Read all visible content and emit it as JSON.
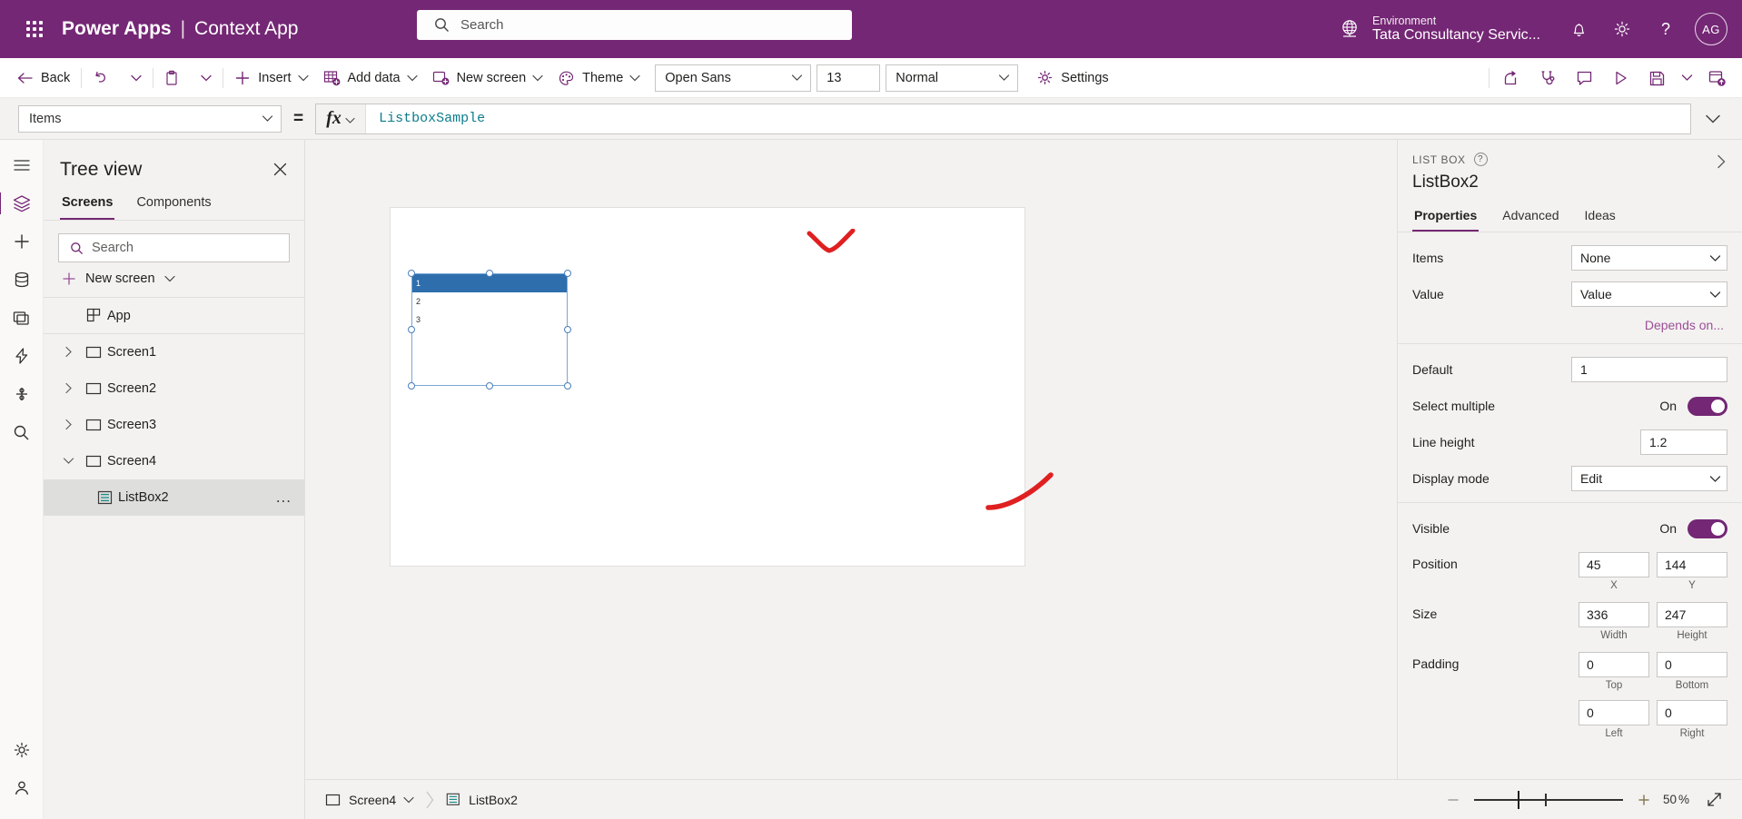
{
  "header": {
    "waffle_icon": "app-launcher-icon",
    "product": "Power Apps",
    "separator": "|",
    "app_name": "Context App",
    "search_placeholder": "Search",
    "search_value": "",
    "search_icon": "search-icon",
    "environment_label": "Environment",
    "environment_value": "Tata Consultancy Servic...",
    "globe_icon": "environment-globe-icon",
    "notification_icon": "bell-icon",
    "settings_icon": "gear-icon",
    "help_icon": "question-mark-icon",
    "avatar_initials": "AG",
    "brand_color": "#742774"
  },
  "command_bar": {
    "back": "Back",
    "back_icon": "arrow-left-icon",
    "undo_icon": "undo-icon",
    "undo_caret_icon": "chevron-down-icon",
    "paste_icon": "clipboard-icon",
    "paste_caret_icon": "chevron-down-icon",
    "insert": "Insert",
    "insert_icon": "plus-icon",
    "add_data": "Add data",
    "add_data_icon": "table-add-icon",
    "new_screen": "New screen",
    "new_screen_icon": "screen-add-icon",
    "theme": "Theme",
    "theme_icon": "palette-icon",
    "font_family": "Open Sans",
    "font_size": "13",
    "font_weight": "Normal",
    "settings": "Settings",
    "settings_icon": "gear-icon",
    "more_icon": "ellipsis-icon",
    "share_icon": "share-icon",
    "checker_icon": "app-checker-stethoscope-icon",
    "comments_icon": "comment-icon",
    "preview_icon": "play-triangle-icon",
    "save_icon": "save-disk-icon",
    "save_caret_icon": "chevron-down-icon",
    "publish_icon": "publish-icon"
  },
  "formula_bar": {
    "property": "Items",
    "property_caret_icon": "chevron-down-icon",
    "equals": "=",
    "fx_icon": "fx-icon",
    "fx_caret_icon": "chevron-down-icon",
    "formula": "ListboxSample",
    "expand_icon": "chevron-down-icon"
  },
  "rail": {
    "items": [
      {
        "name": "hamburger-menu-icon",
        "active": false
      },
      {
        "name": "tree-view-layers-icon",
        "active": true
      },
      {
        "name": "insert-plus-icon",
        "active": false
      },
      {
        "name": "data-cylinder-icon",
        "active": false
      },
      {
        "name": "media-icon",
        "active": false
      },
      {
        "name": "power-automate-icon",
        "active": false
      },
      {
        "name": "variables-icon",
        "active": false
      },
      {
        "name": "search-icon",
        "active": false
      }
    ],
    "bottom_items": [
      {
        "name": "settings-gear-icon"
      },
      {
        "name": "account-person-icon"
      }
    ]
  },
  "tree_view": {
    "title": "Tree view",
    "close_icon": "close-icon",
    "tabs": [
      {
        "label": "Screens",
        "active": true
      },
      {
        "label": "Components",
        "active": false
      }
    ],
    "search_placeholder": "Search",
    "search_value": "",
    "search_icon": "search-icon",
    "new_screen": "New screen",
    "new_screen_plus_icon": "plus-icon",
    "new_screen_caret_icon": "chevron-down-icon",
    "items": [
      {
        "label": "App",
        "icon": "app-grid-icon",
        "indent": 0,
        "chevron": "none",
        "selected": false,
        "divider": true
      },
      {
        "label": "Screen1",
        "icon": "screen-rect-icon",
        "indent": 1,
        "chevron": "right",
        "selected": false
      },
      {
        "label": "Screen2",
        "icon": "screen-rect-icon",
        "indent": 1,
        "chevron": "right",
        "selected": false
      },
      {
        "label": "Screen3",
        "icon": "screen-rect-icon",
        "indent": 1,
        "chevron": "right",
        "selected": false
      },
      {
        "label": "Screen4",
        "icon": "screen-rect-icon",
        "indent": 1,
        "chevron": "down",
        "selected": false
      },
      {
        "label": "ListBox2",
        "icon": "listbox-icon",
        "indent": 2,
        "chevron": "none",
        "selected": true,
        "dots": "..."
      }
    ]
  },
  "canvas": {
    "listbox_items": [
      {
        "label": "1",
        "selected": true
      },
      {
        "label": "2",
        "selected": false
      },
      {
        "label": "3",
        "selected": false
      }
    ],
    "annotation_color": "#e02020"
  },
  "status_bar": {
    "screen_crumb": "Screen4",
    "screen_icon": "screen-rect-icon",
    "screen_caret_icon": "chevron-down-icon",
    "crumb_sep_icon": "chevron-right-icon",
    "control_crumb": "ListBox2",
    "control_icon": "listbox-icon",
    "zoom_out_icon": "minus-icon",
    "zoom_in_icon": "plus-icon",
    "zoom_value": "50",
    "zoom_unit": "%",
    "fit_icon": "fit-to-screen-diagonal-icon"
  },
  "properties_panel": {
    "kind": "LIST BOX",
    "help_icon": "question-mark-circle-icon",
    "collapse_icon": "chevron-right-icon",
    "name": "ListBox2",
    "tabs": [
      {
        "label": "Properties",
        "active": true
      },
      {
        "label": "Advanced",
        "active": false
      },
      {
        "label": "Ideas",
        "active": false
      }
    ],
    "section1": [
      {
        "label": "Items",
        "type": "select",
        "value": "None",
        "caret_icon": "chevron-down-icon"
      },
      {
        "label": "Value",
        "type": "select",
        "value": "Value",
        "caret_icon": "chevron-down-icon"
      }
    ],
    "depends_on": "Depends on...",
    "section2": [
      {
        "label": "Default",
        "type": "text",
        "value": "1"
      },
      {
        "label": "Select multiple",
        "type": "toggle",
        "state": "On"
      },
      {
        "label": "Line height",
        "type": "text-narrow",
        "value": "1.2"
      },
      {
        "label": "Display mode",
        "type": "select",
        "value": "Edit",
        "caret_icon": "chevron-down-icon"
      }
    ],
    "section3": [
      {
        "label": "Visible",
        "type": "toggle",
        "state": "On"
      }
    ],
    "position": {
      "label": "Position",
      "x_value": "45",
      "x_caption": "X",
      "y_value": "144",
      "y_caption": "Y"
    },
    "size": {
      "label": "Size",
      "w_value": "336",
      "w_caption": "Width",
      "h_value": "247",
      "h_caption": "Height"
    },
    "padding": {
      "label": "Padding",
      "top_value": "0",
      "top_caption": "Top",
      "bottom_value": "0",
      "bottom_caption": "Bottom",
      "left_value": "0",
      "left_caption": "Left",
      "right_value": "0",
      "right_caption": "Right"
    },
    "accent_color": "#742774"
  }
}
